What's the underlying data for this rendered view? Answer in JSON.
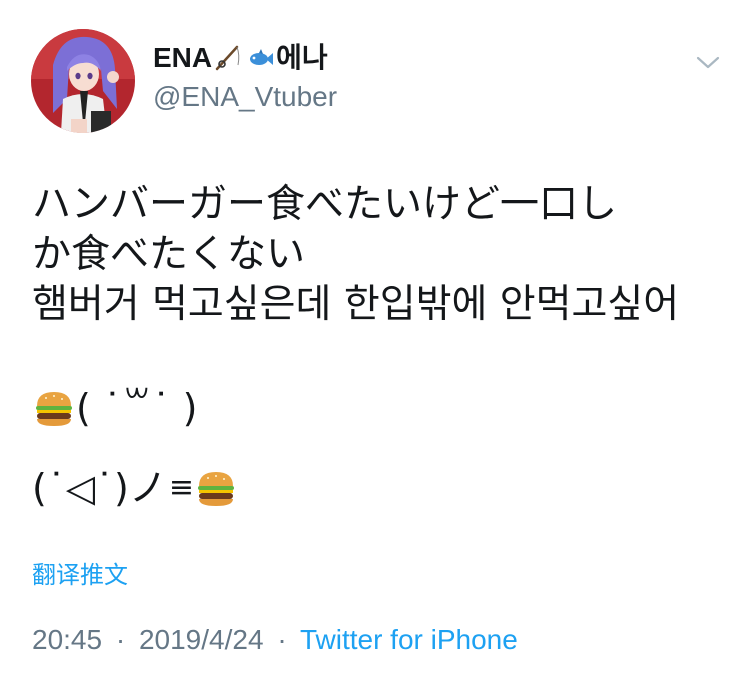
{
  "author": {
    "name_prefix": "ENA",
    "name_suffix": "에나",
    "name_emojis": [
      "fishing-pole-icon",
      "fish-icon"
    ],
    "handle": "@ENA_Vtuber"
  },
  "tweet": {
    "lines": [
      "ハンバーガー食べたいけど一口し",
      "か食べたくない",
      "햄버거 먹고싶은데 한입밖에 안먹고싶어"
    ],
    "emoji_line_1": "( ˙꒳˙ )",
    "emoji_line_2": "(˙◁˙)ノ",
    "emoji_line_2_motion": "≡"
  },
  "translate_label": "翻译推文",
  "meta": {
    "time": "20:45",
    "separator": "·",
    "date": "2019/4/24",
    "source": "Twitter for iPhone"
  },
  "colors": {
    "link": "#1da1f2",
    "secondary_text": "#657786",
    "primary_text": "#14171a"
  }
}
